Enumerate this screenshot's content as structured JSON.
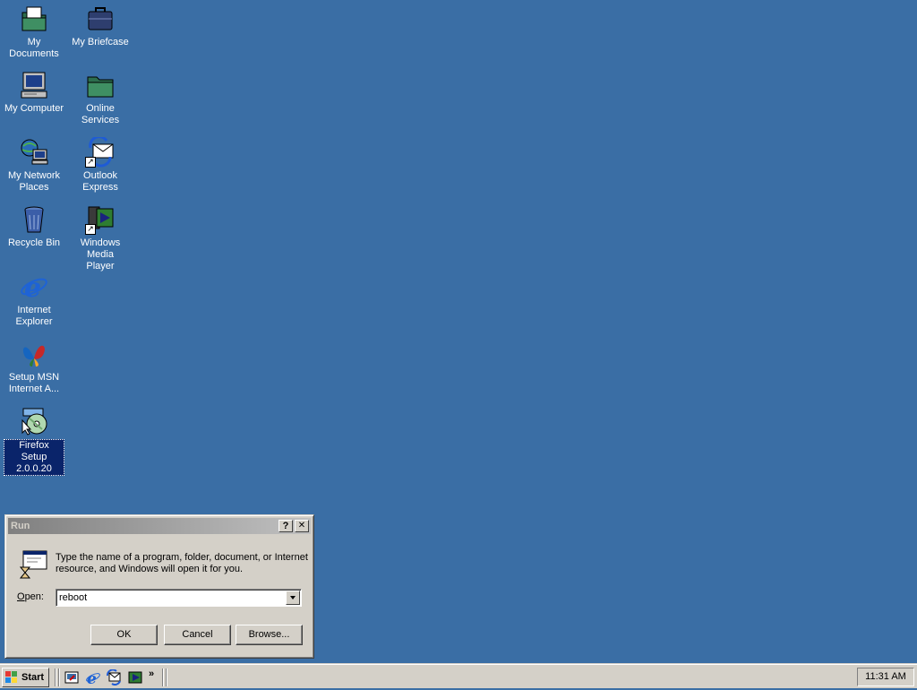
{
  "desktop": {
    "icons": [
      {
        "label": "My Documents",
        "icon": "folder-documents-icon"
      },
      {
        "label": "My Briefcase",
        "icon": "briefcase-icon"
      },
      {
        "label": "My Computer",
        "icon": "computer-icon"
      },
      {
        "label": "Online Services",
        "icon": "folder-icon"
      },
      {
        "label": "My Network Places",
        "icon": "network-icon"
      },
      {
        "label": "Outlook Express",
        "icon": "outlook-express-icon"
      },
      {
        "label": "Recycle Bin",
        "icon": "recycle-bin-icon"
      },
      {
        "label": "Windows Media Player",
        "icon": "media-player-icon"
      },
      {
        "label": "Internet Explorer",
        "icon": "internet-explorer-icon"
      },
      {
        "label": "Setup MSN Internet A...",
        "icon": "msn-butterfly-icon"
      },
      {
        "label": "Firefox Setup 2.0.0.20",
        "icon": "setup-cd-icon",
        "selected": true
      }
    ]
  },
  "run_dialog": {
    "title": "Run",
    "help_button": "?",
    "close_button": "✕",
    "prompt": "Type the name of a program, folder, document, or Internet resource, and Windows will open it for you.",
    "open_label": "Open:",
    "open_value": "reboot",
    "ok_label": "OK",
    "cancel_label": "Cancel",
    "browse_label": "Browse..."
  },
  "taskbar": {
    "start_label": "Start",
    "quick_launch": [
      "desktop-icon",
      "internet-explorer-icon",
      "outlook-express-icon",
      "media-player-icon"
    ],
    "more_label": "»",
    "clock": "11:31 AM"
  },
  "colors": {
    "desktop": "#3a6ea5",
    "chrome": "#d4d0c8",
    "selection": "#0a246a"
  }
}
